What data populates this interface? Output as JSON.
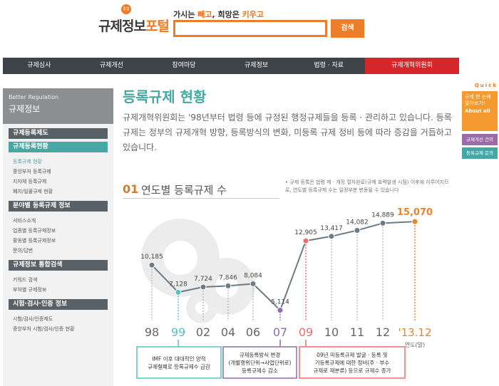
{
  "header": {
    "logo_badge": "통합",
    "logo_text_1": "규제정보",
    "logo_text_2": "포털",
    "slogan_1": "가시는 ",
    "slogan_2": "빼고",
    "slogan_3": ", 희망은 ",
    "slogan_4": "키우고",
    "search_placeholder": "",
    "search_button": "검색"
  },
  "nav": {
    "items": [
      "규제심사",
      "규제개선",
      "참여마당",
      "규제정보",
      "법령 · 자료",
      "규제개혁위원회"
    ]
  },
  "sidebar": {
    "head_en": "Better Regulation",
    "head_ko": "규제정보",
    "cat1": "규제등록제도",
    "cat2": "규제등록현황",
    "cat2_items": [
      "등록규제 현황",
      "중앙부처 등록규제",
      "지자체 등록규제",
      "폐지/일몰규제 현황"
    ],
    "cat3": "분야별 등록규제 정보",
    "cat3_items": [
      "서비스소개",
      "업종별 등록규제정보",
      "활동별 등록규제정보",
      "문의/답변"
    ],
    "cat4": "규제정보 통합검색",
    "cat4_items": [
      "키워드 검색",
      "부처별 규제정보"
    ],
    "cat5": "시험·검사·인증 정보",
    "cat5_items": [
      "시험/검사/인증제도",
      "중앙부처 시험/검사/인증 현황"
    ]
  },
  "quick": {
    "label": "Quick",
    "box_line1": "규제 한 눈에",
    "box_line2": "알아보기!",
    "box_line3": "About all",
    "btn1": "규제개선 건의",
    "btn2": "등록규제 문의"
  },
  "main": {
    "title": "등록규제 현황",
    "intro": "규제개혁위원회는 '98년부터 법령 등에 규정된 행정규제들을 등록 · 관리하고 있습니다. 등록규제는 정부의 규제개혁 방향, 등록방식의 변화, 미등록 규제 정비 등에 따라 증감을 거듭하고 있습니다.",
    "sec_num": "01",
    "sec_title": "연도별 등록규제 수",
    "sec_note": "• 규제 등록은 법령 제 · 개정 절차완료(규제 효력발생 시점) 이후에 이루어지므로, 연도별 등록규제 수는 일정부분 변동될 수 있습니다"
  },
  "chart_data": {
    "type": "line",
    "categories": [
      "98",
      "99",
      "02",
      "04",
      "06",
      "07",
      "09",
      "10",
      "11",
      "12",
      "'13.12"
    ],
    "values": [
      10185,
      7128,
      7724,
      7846,
      8084,
      5114,
      12905,
      13417,
      14082,
      14889,
      15070
    ],
    "value_labels": [
      "10,185",
      "7,128",
      "7,724",
      "7,846",
      "8,084",
      "5,114",
      "12,905",
      "13,417",
      "14,082",
      "14,889",
      "15,070"
    ],
    "unit_label": "연도(말)",
    "highlight": {
      "99": "#56c2c0",
      "07": "#8f6bb0",
      "09": "#ef6b6b",
      "'13.12": "#e9842a"
    },
    "annotations": [
      {
        "line1": "IMF 이후 대대적인 양적",
        "line2": "규제철폐로 등록규제수 급감",
        "color": "#56c2c0"
      },
      {
        "line1": "규제등록방식 변경",
        "line2": "(개별행위단위→사업단위로)",
        "line3": "등록규제수 감소",
        "color": "#8f6bb0"
      },
      {
        "line1": "09년 미등록규제 발굴 · 등록 및",
        "line2": "기등록규제에 대한 정비(주 · 부수",
        "line3": "규제로 재분류) 등으로 규제수 증가",
        "color": "#ef6b6b"
      }
    ],
    "colors": {
      "line": "#6f7b84",
      "point": "#6f7b84",
      "last_label": "#e9842a"
    }
  }
}
